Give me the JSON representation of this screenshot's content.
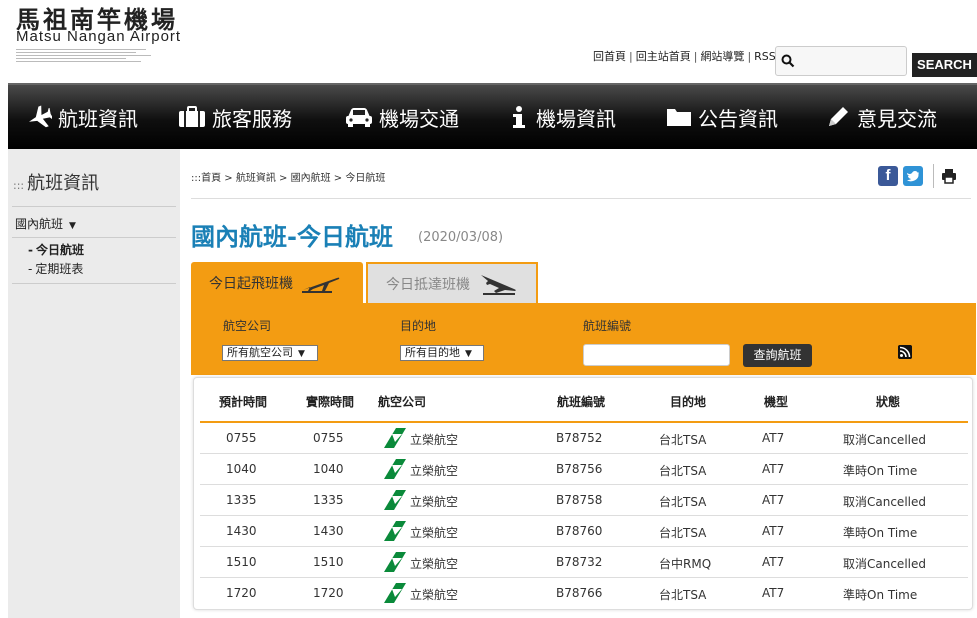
{
  "site": {
    "title": "馬祖南竿機場",
    "subtitle": "Matsu Nangan Airport"
  },
  "toplinks": [
    "回首頁",
    "回主站首頁",
    "網站導覽",
    "RSS"
  ],
  "search": {
    "placeholder": "",
    "button": "SEARCH"
  },
  "nav": [
    {
      "label": "航班資訊",
      "icon": "airplane-icon"
    },
    {
      "label": "旅客服務",
      "icon": "briefcase-icon"
    },
    {
      "label": "機場交通",
      "icon": "car-icon"
    },
    {
      "label": "機場資訊",
      "icon": "info-icon"
    },
    {
      "label": "公告資訊",
      "icon": "folder-icon"
    },
    {
      "label": "意見交流",
      "icon": "pencil-icon"
    }
  ],
  "sidebar": {
    "title": "航班資訊",
    "section": "國內航班",
    "items": [
      "今日航班",
      "定期班表"
    ]
  },
  "breadcrumb": ":::首頁 > 航班資訊 > 國內航班 > 今日航班",
  "page": {
    "title": "國內航班-今日航班",
    "date": "(2020/03/08)"
  },
  "tabs": [
    "今日起飛班機",
    "今日抵達班機"
  ],
  "filter": {
    "airline_label": "航空公司",
    "airline_value": "所有航空公司",
    "dest_label": "目的地",
    "dest_value": "所有目的地",
    "flight_label": "航班編號",
    "query_button": "查詢航班"
  },
  "table": {
    "headers": [
      "預計時間",
      "實際時間",
      "航空公司",
      "航班編號",
      "目的地",
      "機型",
      "狀態"
    ],
    "rows": [
      {
        "sched": "0755",
        "actual": "0755",
        "airline": "立榮航空",
        "flight": "B78752",
        "dest": "台北TSA",
        "type": "AT7",
        "status": "取消Cancelled"
      },
      {
        "sched": "1040",
        "actual": "1040",
        "airline": "立榮航空",
        "flight": "B78756",
        "dest": "台北TSA",
        "type": "AT7",
        "status": "準時On Time"
      },
      {
        "sched": "1335",
        "actual": "1335",
        "airline": "立榮航空",
        "flight": "B78758",
        "dest": "台北TSA",
        "type": "AT7",
        "status": "取消Cancelled"
      },
      {
        "sched": "1430",
        "actual": "1430",
        "airline": "立榮航空",
        "flight": "B78760",
        "dest": "台北TSA",
        "type": "AT7",
        "status": "準時On Time"
      },
      {
        "sched": "1510",
        "actual": "1510",
        "airline": "立榮航空",
        "flight": "B78732",
        "dest": "台中RMQ",
        "type": "AT7",
        "status": "取消Cancelled"
      },
      {
        "sched": "1720",
        "actual": "1720",
        "airline": "立榮航空",
        "flight": "B78766",
        "dest": "台北TSA",
        "type": "AT7",
        "status": "準時On Time"
      }
    ]
  },
  "colors": {
    "accent_orange": "#f39c12",
    "title_blue": "#1a80b6",
    "airline_green": "#0a8a3a"
  }
}
